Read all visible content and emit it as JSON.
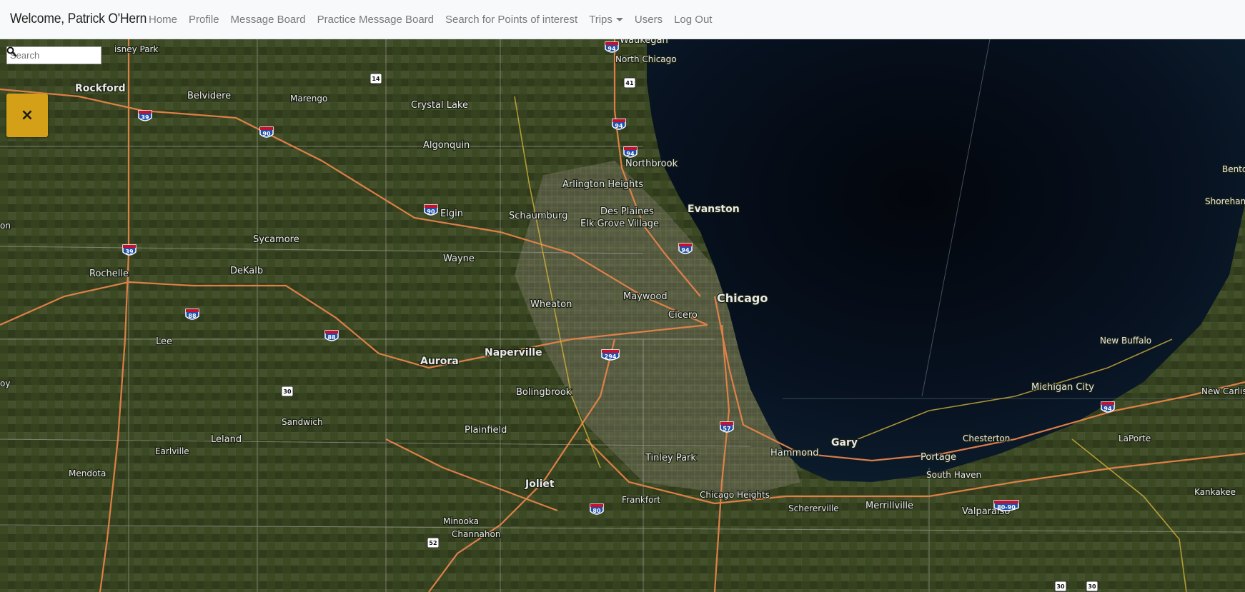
{
  "navbar": {
    "brand": "Welcome, Patrick O'Hern",
    "links": {
      "home": "Home",
      "profile": "Profile",
      "message_board": "Message Board",
      "practice_message_board": "Practice Message Board",
      "search_poi": "Search for Points of interest",
      "trips": "Trips",
      "users": "Users",
      "logout": "Log Out"
    }
  },
  "map": {
    "search": {
      "placeholder": "Search",
      "value": ""
    },
    "close_label": "×",
    "places": {
      "waukegan": "Waukegan",
      "north_chicago": "North Chicago",
      "rockford": "Rockford",
      "belvidere": "Belvidere",
      "marengo": "Marengo",
      "crystal_lake": "Crystal Lake",
      "algonquin": "Algonquin",
      "northbrook": "Northbrook",
      "arlington_heights": "Arlington Heights",
      "evanston": "Evanston",
      "des_plaines": "Des Plaines",
      "elgin": "Elgin",
      "schaumburg": "Schaumburg",
      "elk_grove_village": "Elk Grove Village",
      "sycamore": "Sycamore",
      "wayne": "Wayne",
      "dekalb": "DeKalb",
      "rochelle": "Rochelle",
      "maywood": "Maywood",
      "chicago": "Chicago",
      "wheaton": "Wheaton",
      "cicero": "Cicero",
      "lee": "Lee",
      "aurora": "Aurora",
      "naperville": "Naperville",
      "bolingbrook": "Bolingbrook",
      "sandwich": "Sandwich",
      "plainfield": "Plainfield",
      "leland": "Leland",
      "earlville": "Earlville",
      "mendota": "Mendota",
      "joliet": "Joliet",
      "tinley_park": "Tinley Park",
      "hammond": "Hammond",
      "gary": "Gary",
      "frankfort": "Frankfort",
      "chicago_heights": "Chicago Heights",
      "schererville": "Schererville",
      "merrillville": "Merrillville",
      "minooka": "Minooka",
      "channahon": "Channahon",
      "portage": "Portage",
      "south_haven": "South Haven",
      "chesterton": "Chesterton",
      "valparaiso": "Valparaiso",
      "michigan_city": "Michigan City",
      "new_buffalo": "New Buffalo",
      "new_carlisle": "New Carlis",
      "laporte": "LaPorte",
      "kankakee": "Kankakee",
      "shoreham": "Shoreham",
      "benton": "Bento",
      "disney_park": "isney Park",
      "on": "on",
      "oy": "oy"
    },
    "shields": {
      "i94": "94",
      "i90": "90",
      "i39": "39",
      "i88": "88",
      "i294": "294",
      "i57": "57",
      "i80": "80",
      "i8090": "80-90",
      "us14": "14",
      "us41": "41",
      "us30": "30",
      "us52": "52"
    }
  }
}
